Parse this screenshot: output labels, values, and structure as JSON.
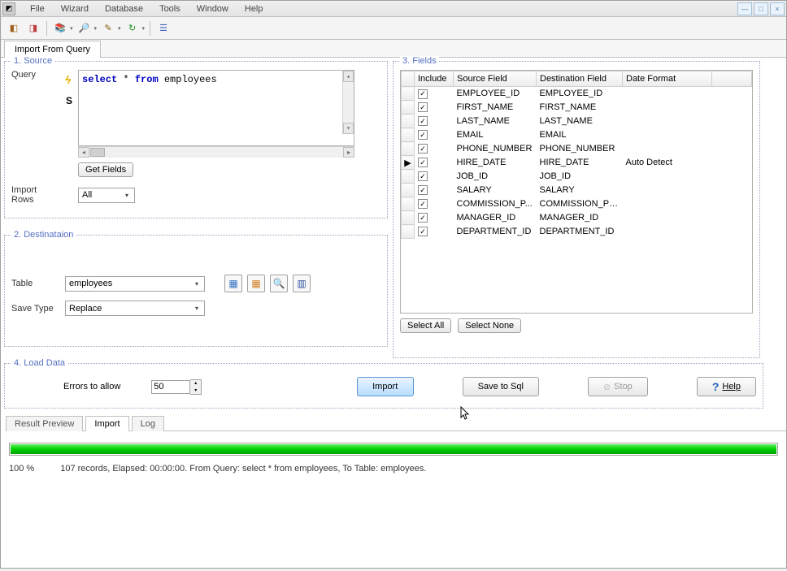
{
  "menu": [
    "File",
    "Wizard",
    "Database",
    "Tools",
    "Window",
    "Help"
  ],
  "outer_tab": "Import From Query",
  "source": {
    "legend": "1. Source",
    "query_label": "Query",
    "query_text": "select * from employees",
    "get_fields_btn": "Get Fields",
    "import_rows_label": "Import Rows",
    "import_rows_value": "All"
  },
  "destination": {
    "legend": "2. Destinataion",
    "table_label": "Table",
    "table_value": "employees",
    "save_type_label": "Save Type",
    "save_type_value": "Replace"
  },
  "fields": {
    "legend": "3. Fields",
    "columns": {
      "include": "Include",
      "src": "Source Field",
      "dest": "Destination Field",
      "fmt": "Date Format"
    },
    "rows": [
      {
        "src": "EMPLOYEE_ID",
        "dest": "EMPLOYEE_ID",
        "fmt": ""
      },
      {
        "src": "FIRST_NAME",
        "dest": "FIRST_NAME",
        "fmt": ""
      },
      {
        "src": "LAST_NAME",
        "dest": "LAST_NAME",
        "fmt": ""
      },
      {
        "src": "EMAIL",
        "dest": "EMAIL",
        "fmt": ""
      },
      {
        "src": "PHONE_NUMBER",
        "dest": "PHONE_NUMBER",
        "fmt": ""
      },
      {
        "src": "HIRE_DATE",
        "dest": "HIRE_DATE",
        "fmt": "Auto Detect"
      },
      {
        "src": "JOB_ID",
        "dest": "JOB_ID",
        "fmt": ""
      },
      {
        "src": "SALARY",
        "dest": "SALARY",
        "fmt": ""
      },
      {
        "src": "COMMISSION_P...",
        "dest": "COMMISSION_PCT",
        "fmt": ""
      },
      {
        "src": "MANAGER_ID",
        "dest": "MANAGER_ID",
        "fmt": ""
      },
      {
        "src": "DEPARTMENT_ID",
        "dest": "DEPARTMENT_ID",
        "fmt": ""
      }
    ],
    "current_row_index": 5,
    "select_all": "Select All",
    "select_none": "Select None"
  },
  "load": {
    "legend": "4. Load Data",
    "errors_label": "Errors to allow",
    "errors_value": "50",
    "import_btn": "Import",
    "save_sql_btn": "Save to Sql",
    "stop_btn": "Stop",
    "help_btn": "Help"
  },
  "bottom_tabs": {
    "preview": "Result Preview",
    "import": "Import",
    "log": "Log"
  },
  "progress": {
    "percent_label": "100 %",
    "percent": 100,
    "status": "107 records,    Elapsed: 00:00:00.    From Query: select * from employees,    To Table: employees."
  }
}
